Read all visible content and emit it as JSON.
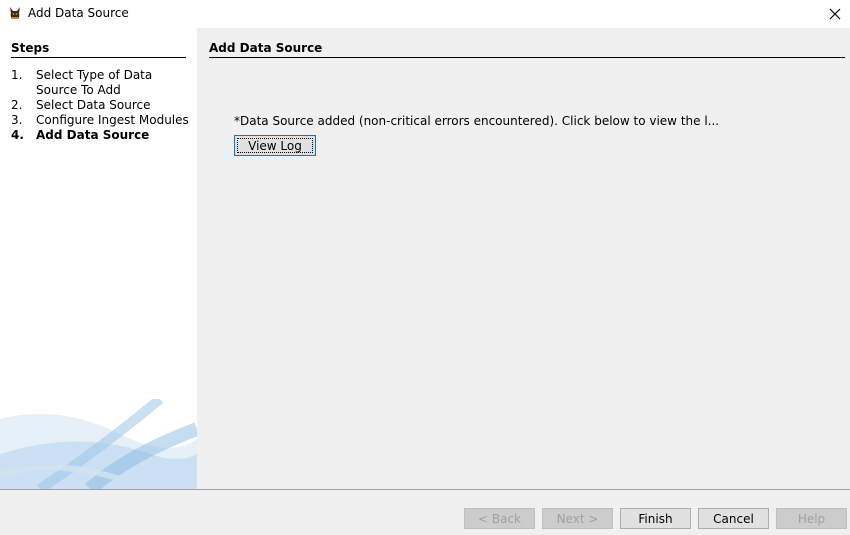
{
  "window": {
    "title": "Add Data Source",
    "close_glyph": "✕"
  },
  "steps": {
    "heading": "Steps",
    "items": [
      {
        "num": "1.",
        "label": "Select Type of Data Source To Add"
      },
      {
        "num": "2.",
        "label": "Select Data Source"
      },
      {
        "num": "3.",
        "label": "Configure Ingest Modules"
      },
      {
        "num": "4.",
        "label": "Add Data Source"
      }
    ]
  },
  "main": {
    "heading": "Add Data Source",
    "status_message": "*Data Source added (non-critical errors encountered). Click below to view the l...",
    "view_log_label": "View Log"
  },
  "footer": {
    "back_label": "< Back",
    "next_label": "Next >",
    "finish_label": "Finish",
    "cancel_label": "Cancel",
    "help_label": "Help"
  },
  "icons": {
    "app": "autopsy-dog-icon",
    "close": "close-icon"
  },
  "colors": {
    "focus_border": "#0078d7",
    "panel_background": "#f0f0f0",
    "steps_background": "#ffffff"
  }
}
